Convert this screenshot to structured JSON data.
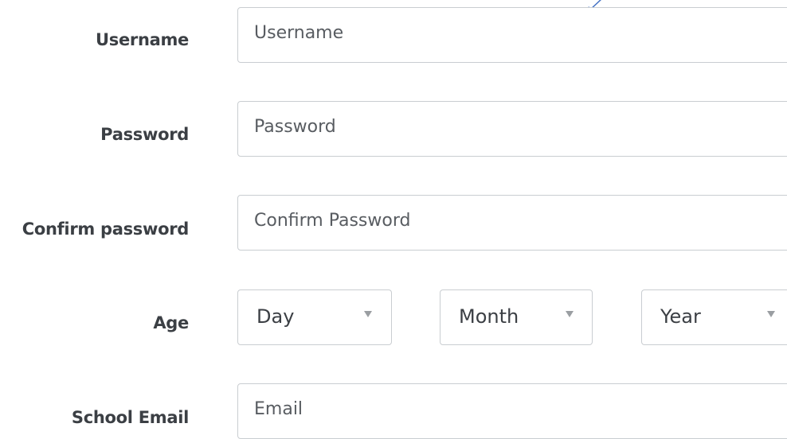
{
  "form": {
    "username": {
      "label": "Username",
      "placeholder": "Username"
    },
    "password": {
      "label": "Password",
      "placeholder": "Password"
    },
    "confirm_password": {
      "label": "Confirm password",
      "placeholder": "Confirm Password"
    },
    "age": {
      "label": "Age",
      "day": "Day",
      "month": "Month",
      "year": "Year"
    },
    "school_email": {
      "label": "School Email",
      "placeholder": "Email"
    }
  },
  "colors": {
    "label_text": "#3b3f44",
    "placeholder_text": "#585c61",
    "field_border": "#c9cdd1",
    "caret": "#9a9ea2",
    "annotation_arrow": "#4472c4"
  }
}
